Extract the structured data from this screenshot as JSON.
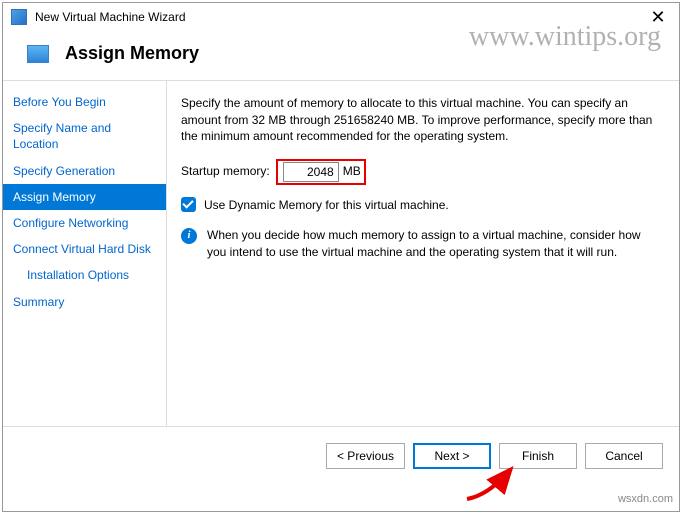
{
  "window": {
    "title": "New Virtual Machine Wizard",
    "close_glyph": "✕"
  },
  "header": {
    "title": "Assign Memory"
  },
  "watermark": "www.wintips.org",
  "watermark2": "wsxdn.com",
  "sidebar": {
    "steps": [
      "Before You Begin",
      "Specify Name and Location",
      "Specify Generation",
      "Assign Memory",
      "Configure Networking",
      "Connect Virtual Hard Disk",
      "Installation Options",
      "Summary"
    ]
  },
  "main": {
    "description": "Specify the amount of memory to allocate to this virtual machine. You can specify an amount from 32 MB through 251658240 MB. To improve performance, specify more than the minimum amount recommended for the operating system.",
    "startup_label": "Startup memory:",
    "startup_value": "2048",
    "startup_unit": "MB",
    "dynamic_label": "Use Dynamic Memory for this virtual machine.",
    "info_text": "When you decide how much memory to assign to a virtual machine, consider how you intend to use the virtual machine and the operating system that it will run."
  },
  "footer": {
    "previous": "< Previous",
    "next": "Next >",
    "finish": "Finish",
    "cancel": "Cancel"
  }
}
